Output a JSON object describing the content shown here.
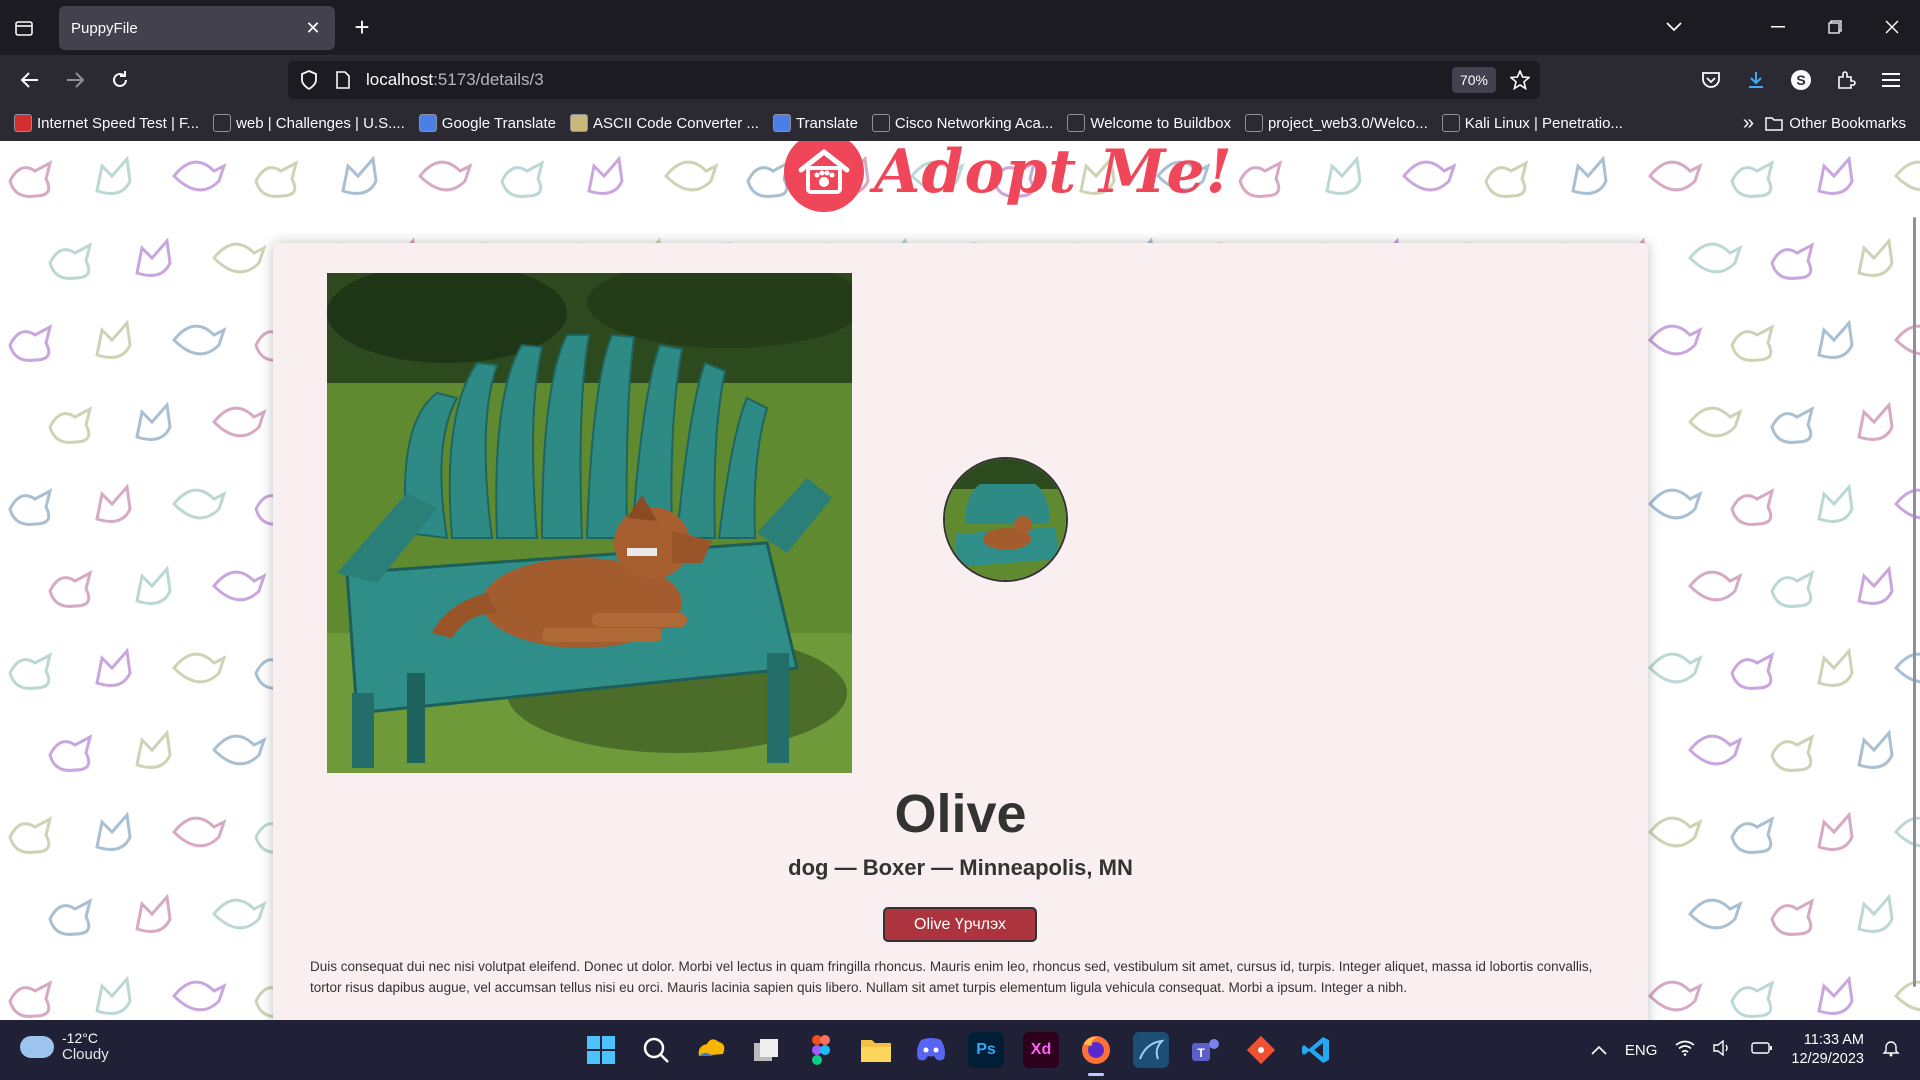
{
  "browser": {
    "tab": {
      "title": "PuppyFile",
      "close_glyph": "✕"
    },
    "url": {
      "host": "localhost",
      "path": ":5173/details/3"
    },
    "zoom": "70%",
    "bookmarks": [
      {
        "label": "Internet Speed Test | F...",
        "icon": "speedtest-icon",
        "color": "#d32f2f"
      },
      {
        "label": "web | Challenges | U.S....",
        "icon": "globe-icon",
        "color": "#2b2a33"
      },
      {
        "label": "Google Translate",
        "icon": "translate-icon",
        "color": "#4a7fe8"
      },
      {
        "label": "ASCII Code Converter ...",
        "icon": "converter-icon",
        "color": "#c8b87a"
      },
      {
        "label": "Translate",
        "icon": "translate-icon",
        "color": "#4a7fe8"
      },
      {
        "label": "Cisco Networking Aca...",
        "icon": "cisco-icon",
        "color": "#2b2a33"
      },
      {
        "label": "Welcome to Buildbox",
        "icon": "globe-icon",
        "color": "#2b2a33"
      },
      {
        "label": "project_web3.0/Welco...",
        "icon": "github-icon",
        "color": "#2b2a33"
      },
      {
        "label": "Kali Linux | Penetratio...",
        "icon": "kali-icon",
        "color": "#2b2a33"
      }
    ],
    "other_bookmarks": "Other Bookmarks"
  },
  "page": {
    "logo_text": "Adopt Me!",
    "pet": {
      "name": "Olive",
      "meta": "dog — Boxer — Minneapolis, MN",
      "adopt_button": "Olive Үрчлэх",
      "description": "Duis consequat dui nec nisi volutpat eleifend. Donec ut dolor. Morbi vel lectus in quam fringilla rhoncus. Mauris enim leo, rhoncus sed, vestibulum sit amet, cursus id, turpis. Integer aliquet, massa id lobortis convallis, tortor risus dapibus augue, vel accumsan tellus nisi eu orci. Mauris lacinia sapien quis libero. Nullam sit amet turpis elementum ligula vehicula consequat. Morbi a ipsum. Integer a nibh."
    }
  },
  "taskbar": {
    "weather": {
      "temp": "-12°C",
      "condition": "Cloudy"
    },
    "apps": [
      {
        "name": "windows-start",
        "label": "",
        "color": "#202036"
      },
      {
        "name": "search",
        "label": "",
        "color": "#202036"
      },
      {
        "name": "photos",
        "label": "",
        "color": "#202036"
      },
      {
        "name": "task-view",
        "label": "",
        "color": "#202036"
      },
      {
        "name": "figma",
        "label": "",
        "color": "#202036"
      },
      {
        "name": "file-explorer",
        "label": "",
        "color": "#202036"
      },
      {
        "name": "discord",
        "label": "",
        "color": "#202036"
      },
      {
        "name": "photoshop",
        "label": "Ps",
        "color": "#001e36"
      },
      {
        "name": "adobe-xd",
        "label": "Xd",
        "color": "#2e001e"
      },
      {
        "name": "firefox",
        "label": "",
        "color": "#202036"
      },
      {
        "name": "mysql-workbench",
        "label": "",
        "color": "#1d4e75"
      },
      {
        "name": "teams",
        "label": "",
        "color": "#202036"
      },
      {
        "name": "git",
        "label": "",
        "color": "#202036"
      },
      {
        "name": "vscode",
        "label": "",
        "color": "#202036"
      }
    ],
    "tray": {
      "language": "ENG",
      "time": "11:33 AM",
      "date": "12/29/2023"
    }
  },
  "colors": {
    "accent_red": "#f0465a",
    "adopt_button": "#ad343e",
    "card_bg": "#faeff0"
  }
}
